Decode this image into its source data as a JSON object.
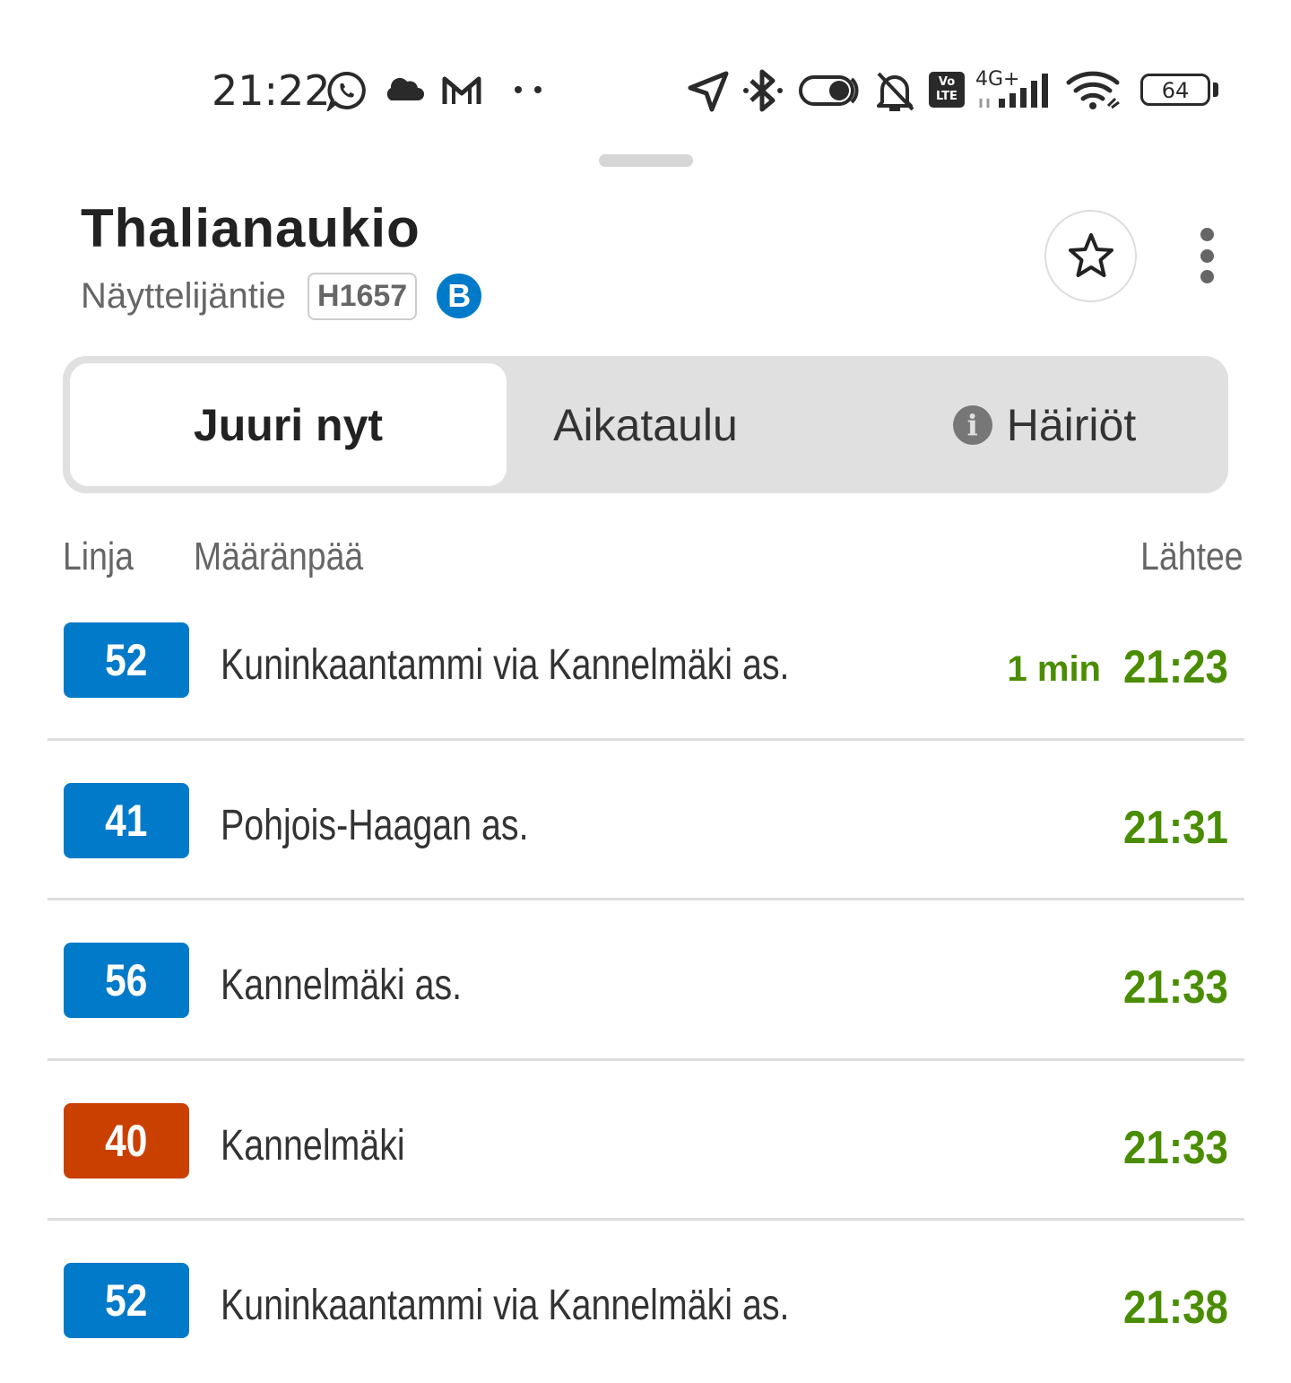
{
  "status_bar": {
    "time": "21:22",
    "network": "4G+",
    "volte": "Vo LTE",
    "battery": "64",
    "icons": [
      "whatsapp-icon",
      "cloud-icon",
      "gmail-icon",
      "more-notifications-icon",
      "location-icon",
      "bluetooth-icon",
      "toggle-icon",
      "bell-off-icon",
      "volte-icon",
      "signal-icon",
      "wifi-icon",
      "battery-icon"
    ]
  },
  "stop": {
    "name": "Thalianaukio",
    "street": "Näyttelijäntie",
    "code": "H1657",
    "mode_letter": "B"
  },
  "tabs": [
    {
      "label": "Juuri nyt",
      "active": true
    },
    {
      "label": "Aikataulu",
      "active": false
    },
    {
      "label": "Häiriöt",
      "active": false,
      "icon": "info-icon"
    }
  ],
  "columns": {
    "line": "Linja",
    "destination": "Määränpää",
    "departs": "Lähtee"
  },
  "departures": [
    {
      "route": "52",
      "color": "#007ac9",
      "destination": "Kuninkaantammi via Kannelmäki as.",
      "minutes": "1 min",
      "time": "21:23"
    },
    {
      "route": "41",
      "color": "#007ac9",
      "destination": "Pohjois-Haagan as.",
      "minutes": "",
      "time": "21:31"
    },
    {
      "route": "56",
      "color": "#007ac9",
      "destination": "Kannelmäki as.",
      "minutes": "",
      "time": "21:33"
    },
    {
      "route": "40",
      "color": "#ca4000",
      "destination": "Kannelmäki",
      "minutes": "",
      "time": "21:33"
    },
    {
      "route": "52",
      "color": "#007ac9",
      "destination": "Kuninkaantammi via Kannelmäki as.",
      "minutes": "",
      "time": "21:38"
    }
  ],
  "colors": {
    "hsl_blue": "#007ac9",
    "trunk_orange": "#ca4000",
    "realtime_green": "#4a8d00"
  }
}
